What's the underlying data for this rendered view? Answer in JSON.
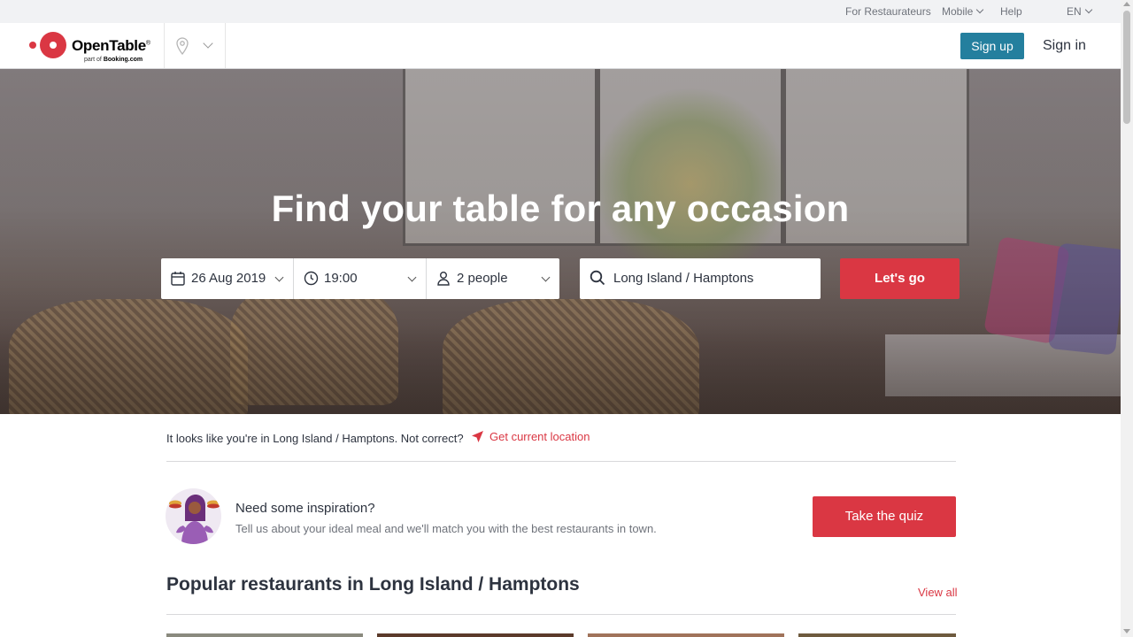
{
  "utility_bar": {
    "for_restaurateurs": "For Restaurateurs",
    "mobile": "Mobile",
    "help": "Help",
    "language": "EN"
  },
  "header": {
    "logo_text": "OpenTable",
    "logo_reg": "®",
    "logo_sub_prefix": "part of",
    "logo_sub_brand": "Booking.com",
    "sign_up": "Sign up",
    "sign_in": "Sign in"
  },
  "hero": {
    "title": "Find your table for any occasion",
    "date": "26 Aug 2019",
    "time": "19:00",
    "party": "2 people",
    "location": "Long Island / Hamptons",
    "submit": "Let's go"
  },
  "location_notice": {
    "text": "It looks like you're in Long Island / Hamptons. Not correct?",
    "link": "Get current location"
  },
  "inspiration": {
    "title": "Need some inspiration?",
    "description": "Tell us about your ideal meal and we'll match you with the best restaurants in town.",
    "button": "Take the quiz"
  },
  "popular": {
    "title": "Popular restaurants in Long Island / Hamptons",
    "view_all": "View all"
  },
  "colors": {
    "brand_red": "#da3743",
    "sign_up_blue": "#247f9e",
    "text_dark": "#2d333f",
    "text_muted": "#6f737b"
  },
  "icons": [
    "location-pin-icon",
    "calendar-icon",
    "clock-icon",
    "person-icon",
    "search-icon",
    "navigation-arrow-icon"
  ]
}
